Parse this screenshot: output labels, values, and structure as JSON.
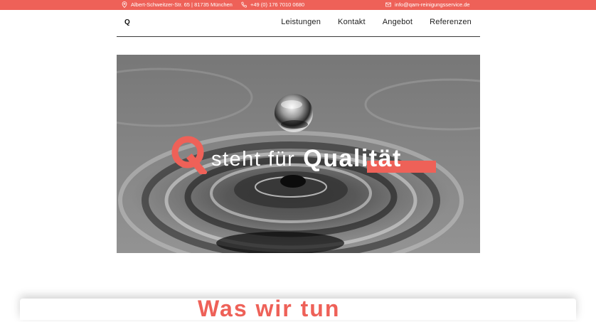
{
  "topbar": {
    "address": "Albert-Schweitzer-Str. 65 | 81735 München",
    "phone": "+49 (0) 176 7010 0680",
    "email": "info@qam-reinigungsservice.de",
    "address_icon": "location-pin-icon",
    "phone_icon": "phone-icon",
    "email_icon": "mail-icon",
    "color": "#ee6158"
  },
  "nav": {
    "logo": "Q",
    "items": [
      {
        "label": "Leistungen"
      },
      {
        "label": "Kontakt"
      },
      {
        "label": "Angebot"
      },
      {
        "label": "Referenzen"
      }
    ]
  },
  "hero": {
    "q_letter": "Q",
    "text_plain": "steht für",
    "text_bold": "Qualität",
    "accent": "#ee6158"
  },
  "section": {
    "heading": "Was wir tun"
  }
}
